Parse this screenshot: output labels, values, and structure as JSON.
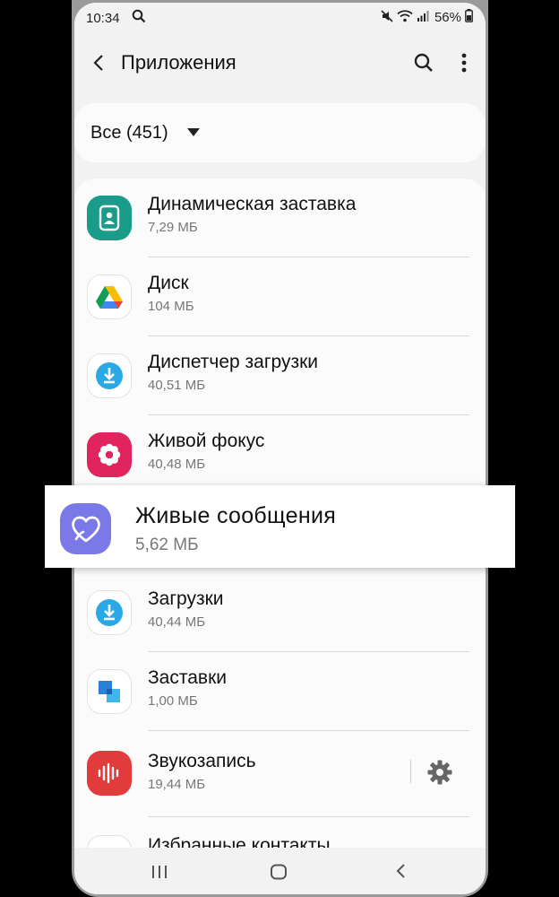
{
  "status_bar": {
    "time": "10:34",
    "battery": "56%"
  },
  "app_bar": {
    "title": "Приложения"
  },
  "filter": {
    "label": "Все (451)"
  },
  "apps": [
    {
      "name": "Динамическая заставка",
      "size": "7,29 МБ",
      "icon": "dynamic-lockscreen-icon"
    },
    {
      "name": "Диск",
      "size": "104 МБ",
      "icon": "google-drive-icon"
    },
    {
      "name": "Диспетчер загрузки",
      "size": "40,51 МБ",
      "icon": "download-manager-icon"
    },
    {
      "name": "Живой фокус",
      "size": "40,48 МБ",
      "icon": "live-focus-icon"
    },
    {
      "name": "Живые сообщения",
      "size": "5,62 МБ",
      "icon": "live-message-icon"
    },
    {
      "name": "Загрузки",
      "size": "40,44 МБ",
      "icon": "downloads-icon"
    },
    {
      "name": "Заставки",
      "size": "1,00 МБ",
      "icon": "screensavers-icon"
    },
    {
      "name": "Звукозапись",
      "size": "19,44 МБ",
      "icon": "voice-recorder-icon"
    },
    {
      "name": "Избранные контакты",
      "size": "",
      "icon": "favorite-contacts-icon"
    }
  ],
  "colors": {
    "accent_blue": "#2ba8e6",
    "live_message": "#7b78e8",
    "teal": "#1a9c8a",
    "pink": "#e0245e",
    "recorder_red": "#e13b3b"
  }
}
